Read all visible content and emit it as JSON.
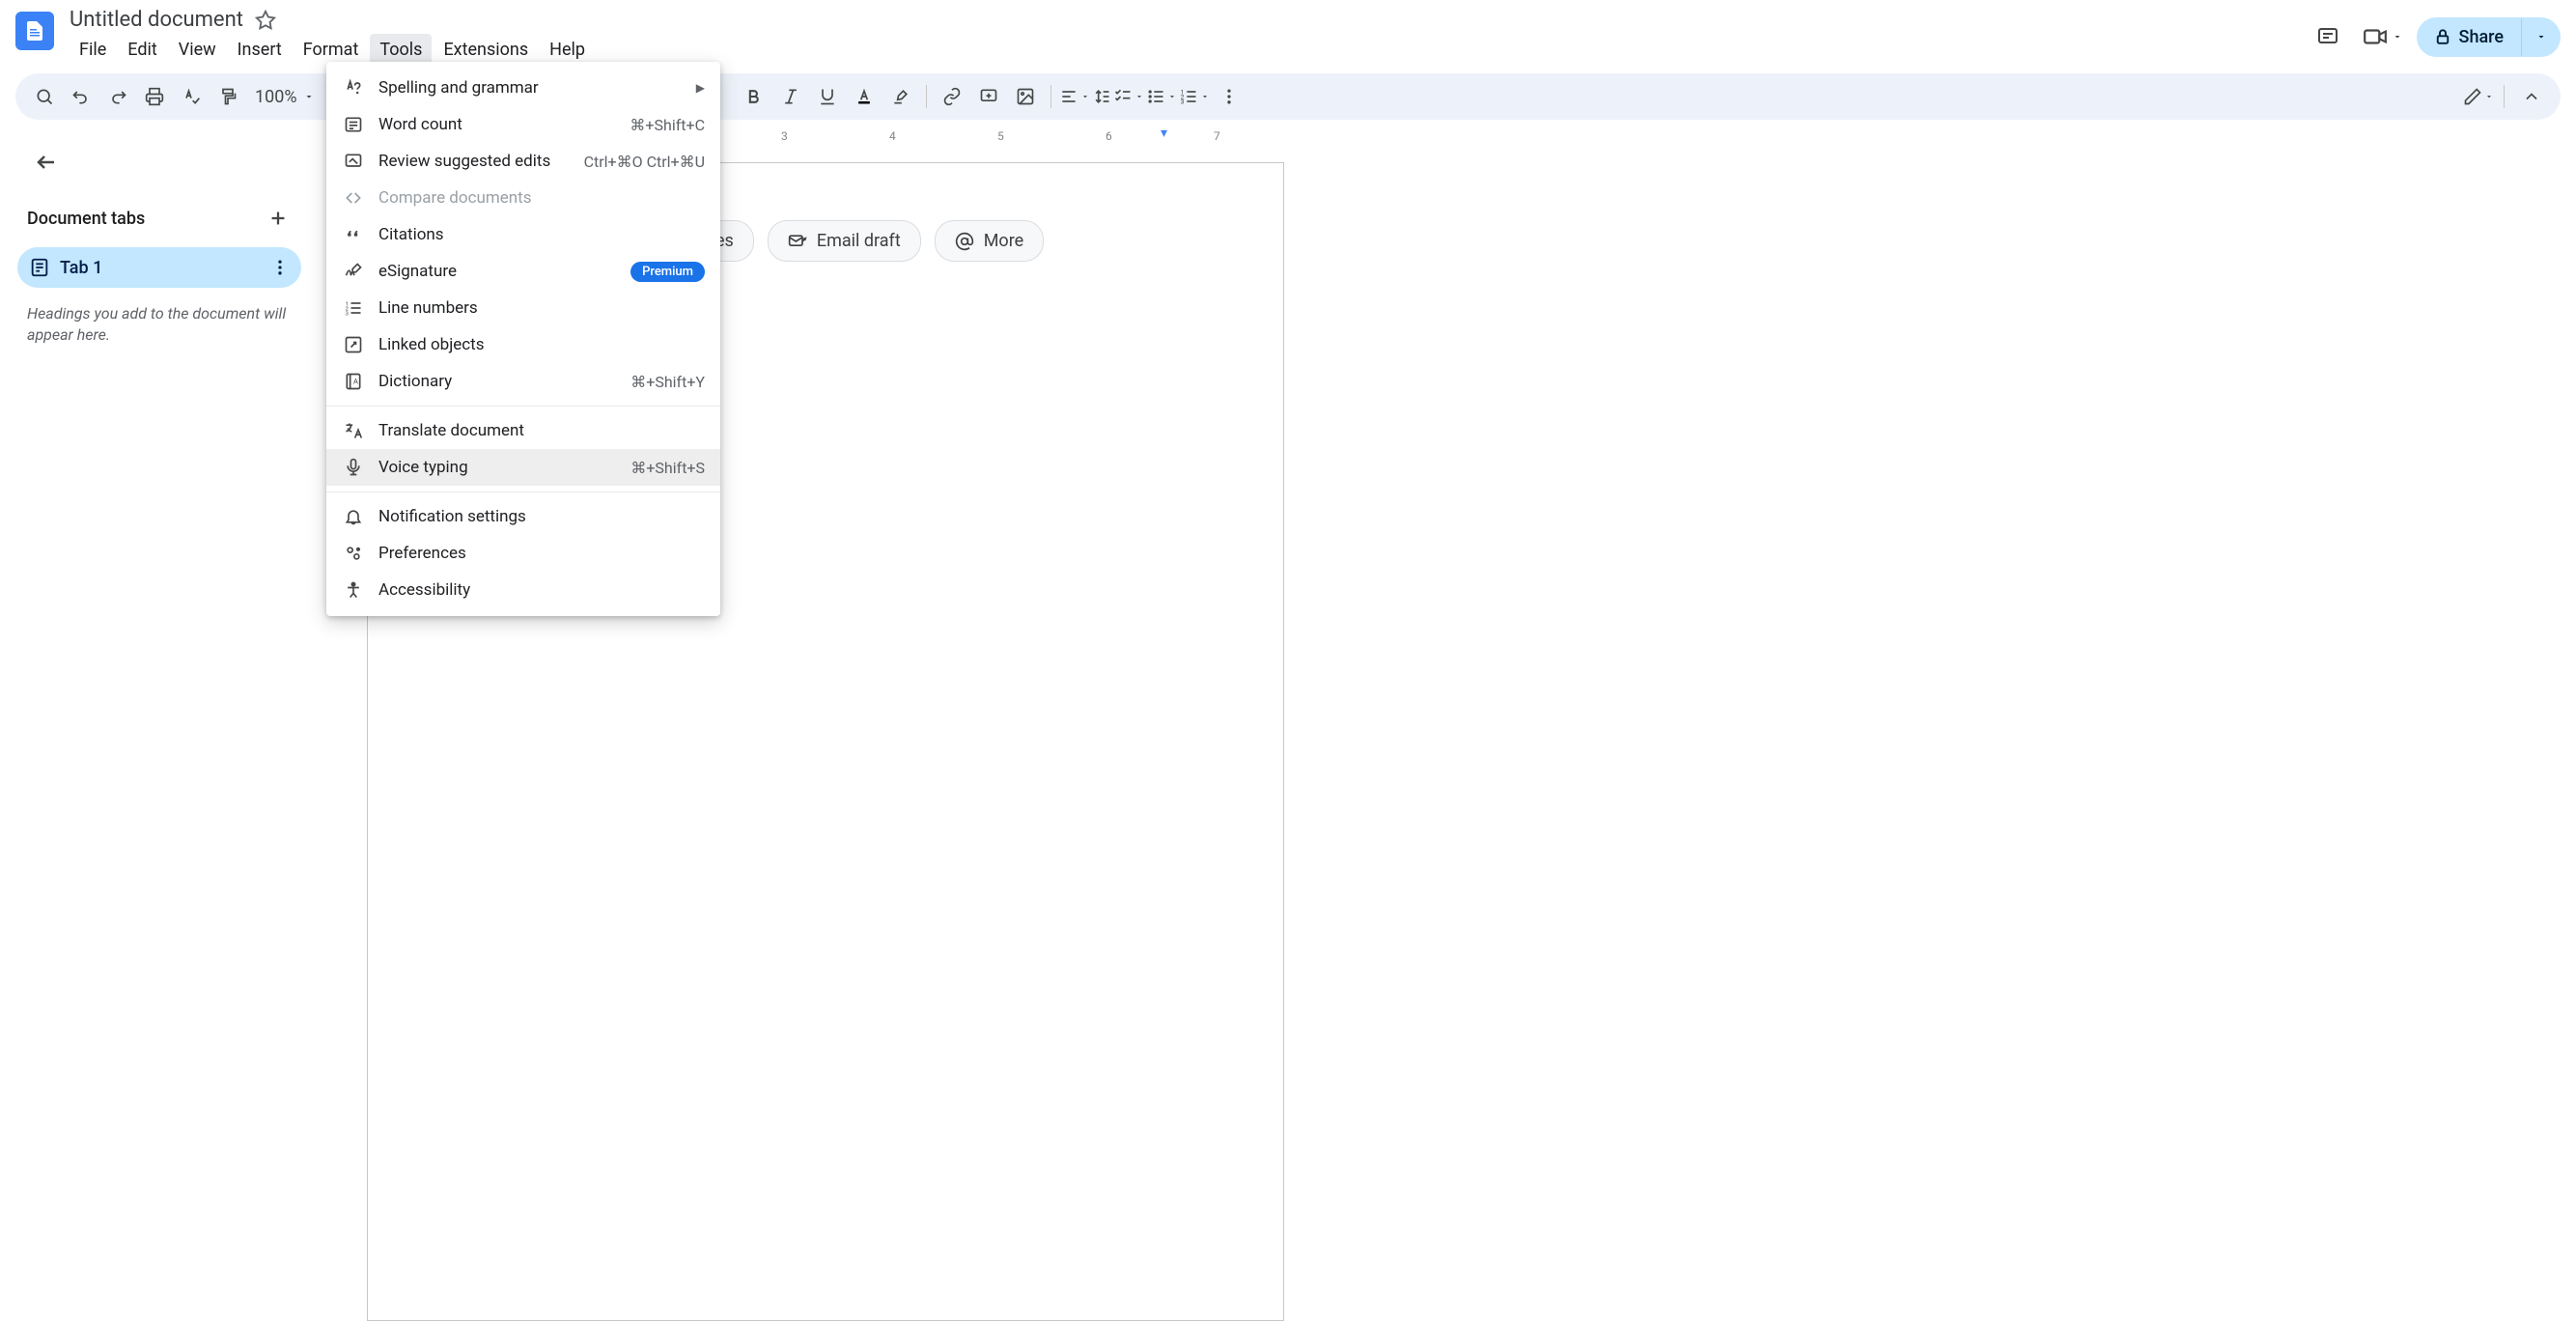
{
  "header": {
    "title": "Untitled document",
    "share_label": "Share"
  },
  "menubar": {
    "file": "File",
    "edit": "Edit",
    "view": "View",
    "insert": "Insert",
    "format": "Format",
    "tools": "Tools",
    "extensions": "Extensions",
    "help": "Help"
  },
  "toolbar": {
    "zoom": "100%"
  },
  "sidebar": {
    "title": "Document tabs",
    "tab1": "Tab 1",
    "hint": "Headings you add to the document will appear here."
  },
  "ruler": {
    "t3": "3",
    "t4": "4",
    "t5": "5",
    "t6": "6",
    "t7": "7"
  },
  "chips": {
    "notes": "es",
    "email": "Email draft",
    "more": "More"
  },
  "tools_menu": {
    "spelling": {
      "label": "Spelling and grammar"
    },
    "wordcount": {
      "label": "Word count",
      "shortcut": "⌘+Shift+C"
    },
    "review": {
      "label": "Review suggested edits",
      "shortcut": "Ctrl+⌘O Ctrl+⌘U"
    },
    "compare": {
      "label": "Compare documents"
    },
    "citations": {
      "label": "Citations"
    },
    "esignature": {
      "label": "eSignature",
      "badge": "Premium"
    },
    "linenumbers": {
      "label": "Line numbers"
    },
    "linkedobjects": {
      "label": "Linked objects"
    },
    "dictionary": {
      "label": "Dictionary",
      "shortcut": "⌘+Shift+Y"
    },
    "translate": {
      "label": "Translate document"
    },
    "voicetyping": {
      "label": "Voice typing",
      "shortcut": "⌘+Shift+S"
    },
    "notification": {
      "label": "Notification settings"
    },
    "preferences": {
      "label": "Preferences"
    },
    "accessibility": {
      "label": "Accessibility"
    }
  }
}
